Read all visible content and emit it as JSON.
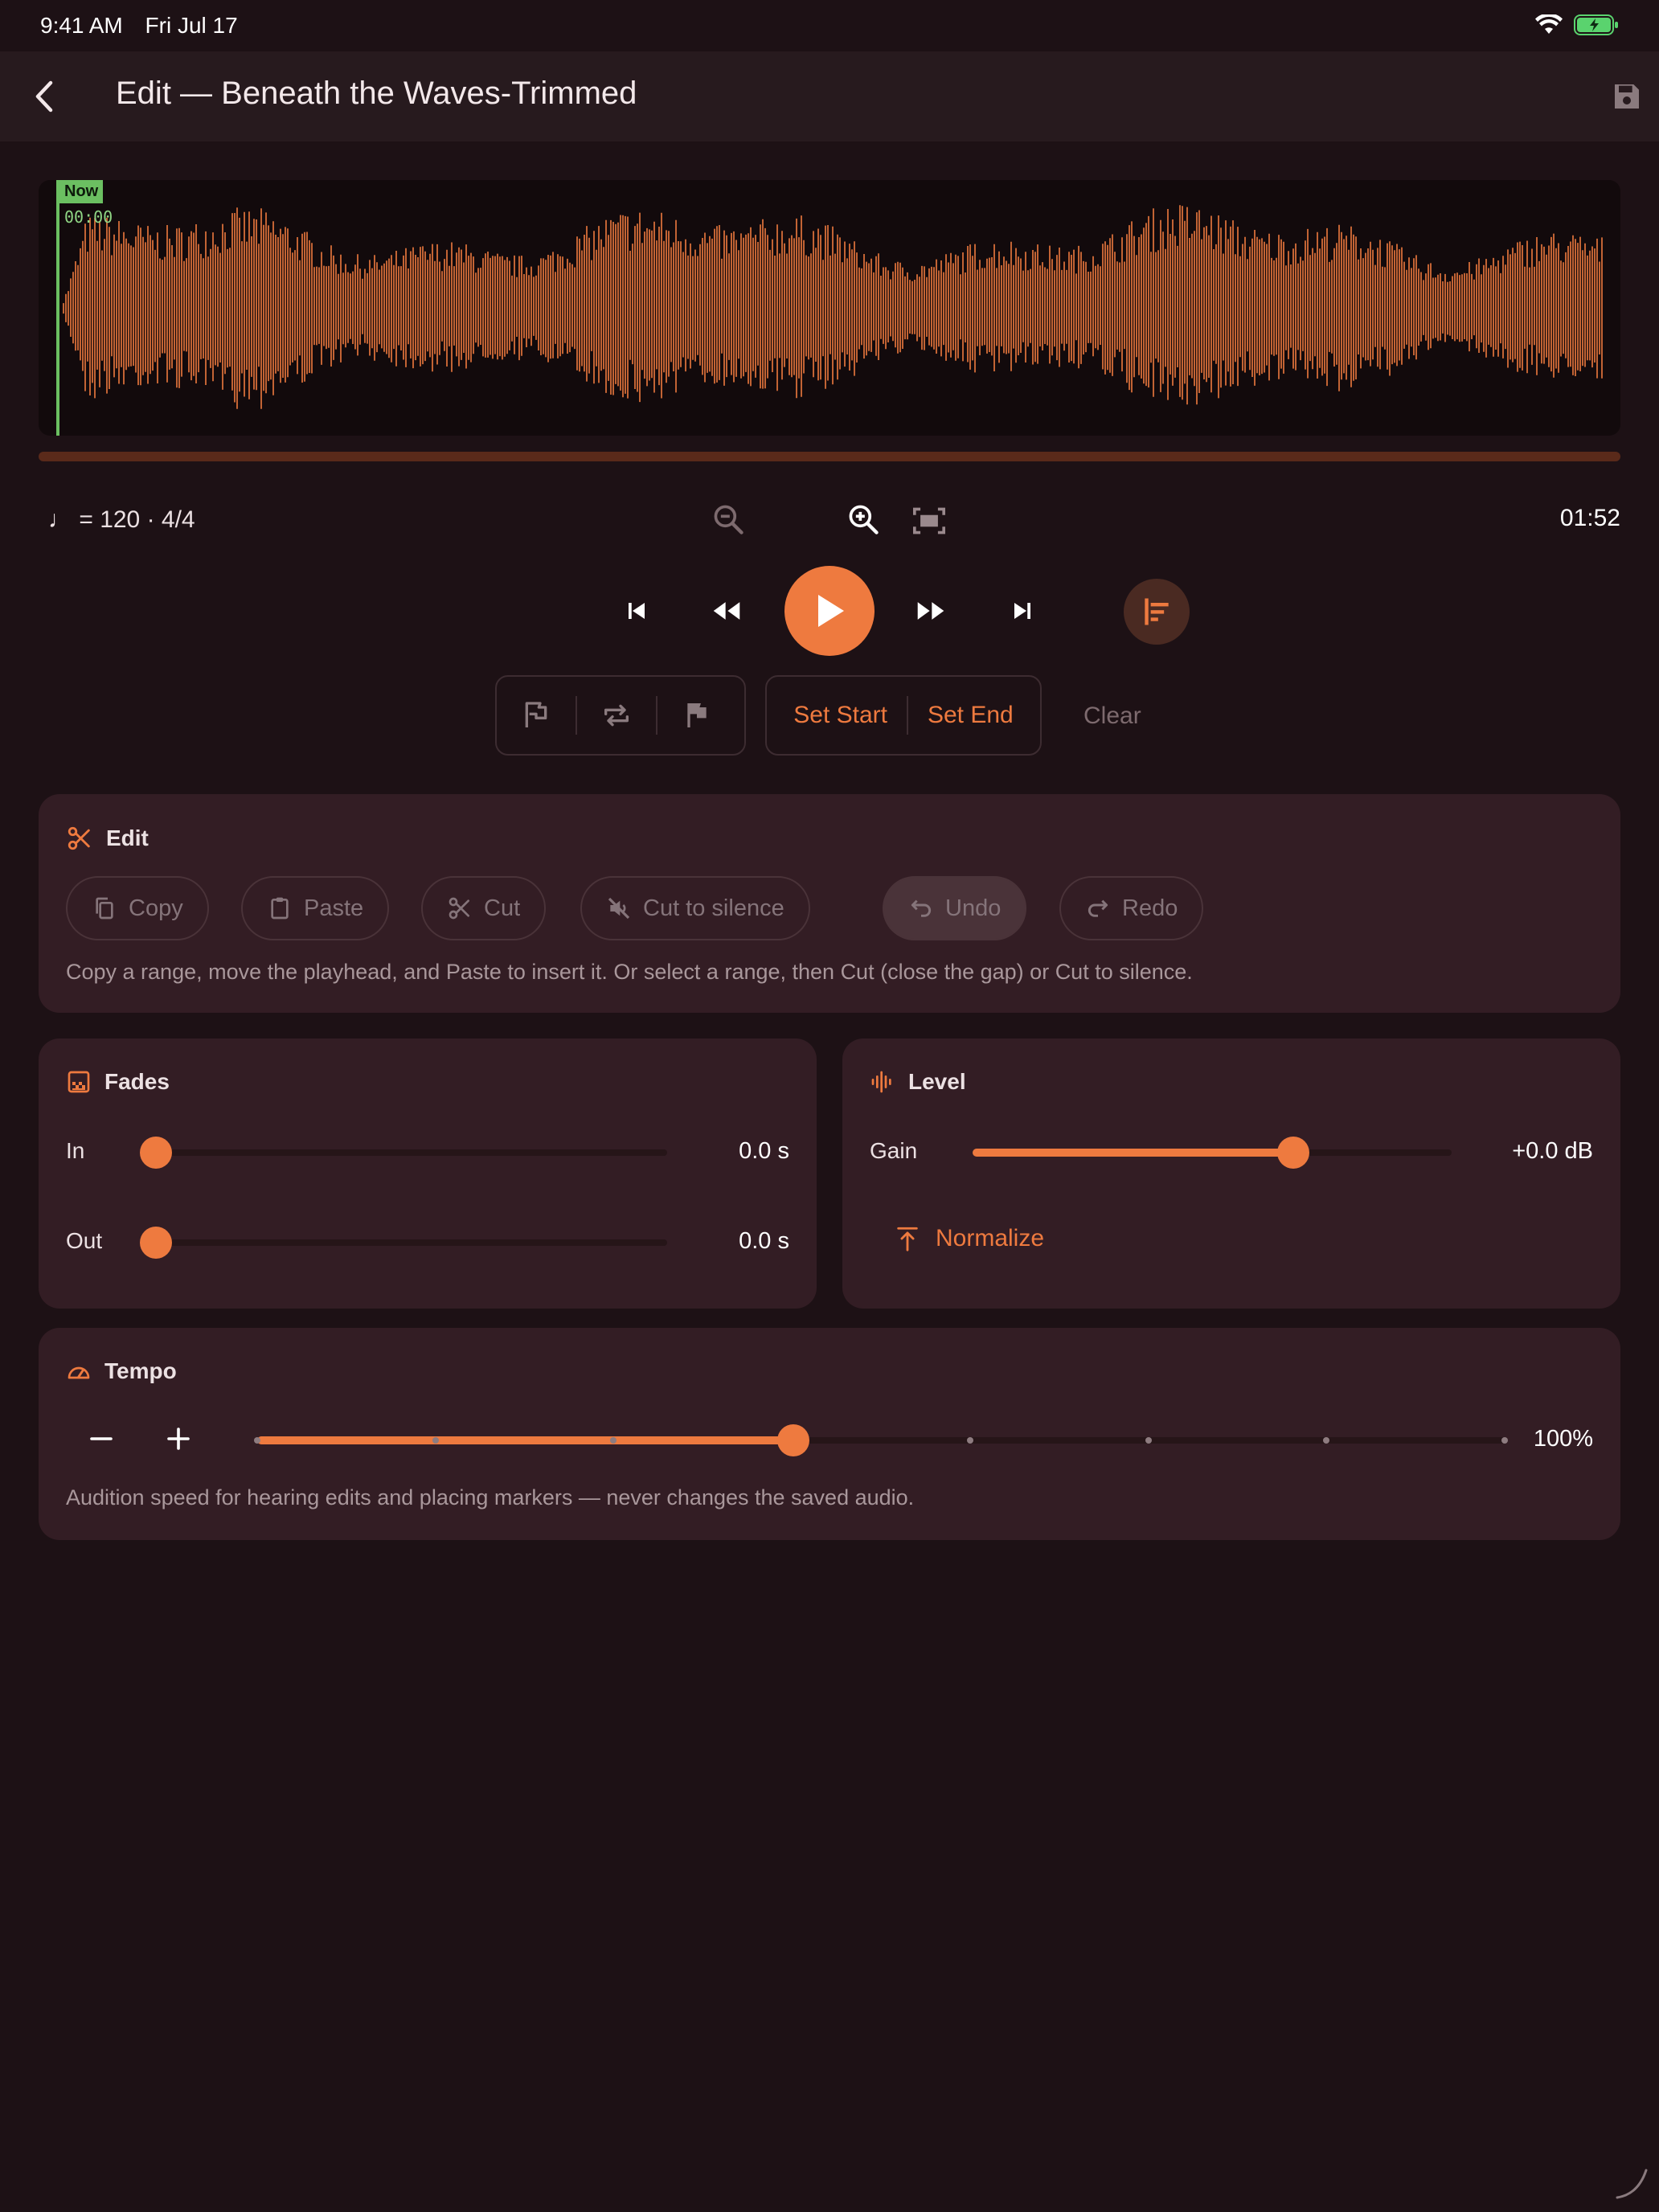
{
  "status_bar": {
    "time": "9:41 AM",
    "date": "Fri Jul 17"
  },
  "app_bar": {
    "title": "Edit — Beneath the Waves-Trimmed",
    "back_icon": "chevron-left-icon",
    "save_icon": "save-icon"
  },
  "waveform": {
    "now_label": "Now",
    "now_time": "00:00",
    "color": "#ee7a3f",
    "playhead_color": "#6bbf61"
  },
  "info": {
    "tempo": "♩ = 120 · 4/4",
    "duration": "01:52"
  },
  "transport": {
    "icons": [
      "skip-start-icon",
      "rewind-icon",
      "play-icon",
      "fast-forward-icon",
      "skip-end-icon",
      "follow-playhead-icon"
    ]
  },
  "markers": {
    "set_start": "Set Start",
    "set_end": "Set End",
    "clear": "Clear"
  },
  "edit": {
    "title": "Edit",
    "copy": "Copy",
    "paste": "Paste",
    "cut": "Cut",
    "cut_silence": "Cut to silence",
    "undo": "Undo",
    "redo": "Redo",
    "help": "Copy a range, move the playhead, and Paste to insert it. Or select a range, then Cut (close the gap) or Cut to silence."
  },
  "fades": {
    "title": "Fades",
    "in_label": "In",
    "in_value": "0.0 s",
    "in_level": 0,
    "out_label": "Out",
    "out_value": "0.0 s",
    "out_level": 0
  },
  "level": {
    "title": "Level",
    "gain_label": "Gain",
    "gain_value": "+0.0 dB",
    "gain_level": 0.67,
    "normalize": "Normalize"
  },
  "tempo": {
    "title": "Tempo",
    "value": "100%",
    "level": 0.43,
    "help": "Audition speed for hearing edits and placing markers — never changes the saved audio."
  },
  "accent": "#ee7a3f"
}
